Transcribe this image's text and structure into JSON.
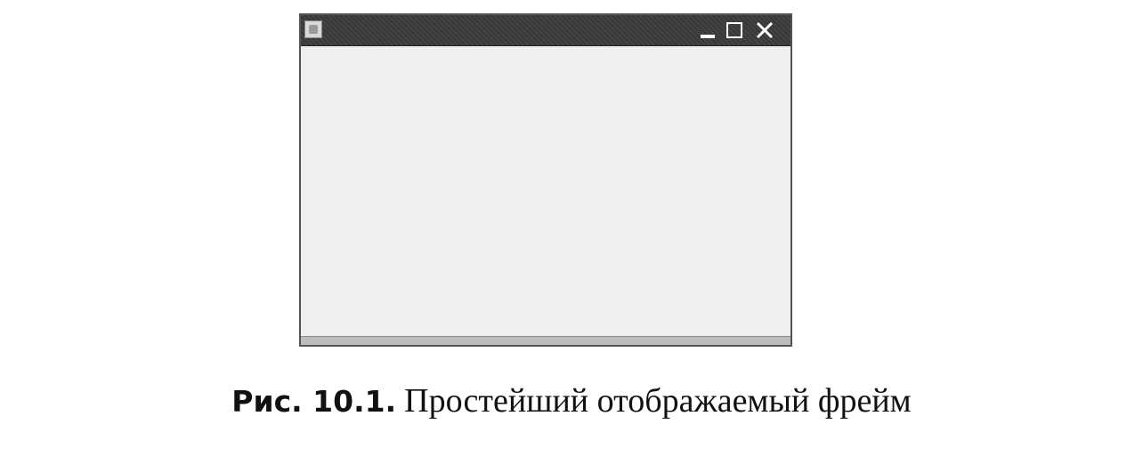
{
  "window": {
    "title": "",
    "icons": {
      "app": "app-icon",
      "minimize": "minimize-icon",
      "maximize": "maximize-icon",
      "close": "close-icon"
    },
    "colors": {
      "titlebar": "#3a3a3a",
      "content": "#efefef",
      "border": "#555555"
    }
  },
  "caption": {
    "label": "Рис. 10.1.",
    "text": "Простейший отображаемый фрейм"
  }
}
